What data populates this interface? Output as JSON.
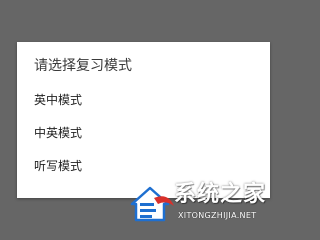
{
  "dialog": {
    "title": "请选择复习模式",
    "options": [
      {
        "label": "英中模式"
      },
      {
        "label": "中英模式"
      },
      {
        "label": "听写模式"
      }
    ]
  },
  "watermark": {
    "brand": "系统之家",
    "url": "XITONGZHIJIA.NET",
    "icon": "system-logo-icon"
  },
  "colors": {
    "backdrop": "#666666",
    "dialog_bg": "#ffffff",
    "title_text": "#3a3a3a",
    "option_text": "#222222",
    "logo_blue": "#1e6fd0",
    "logo_red": "#d9302b"
  }
}
